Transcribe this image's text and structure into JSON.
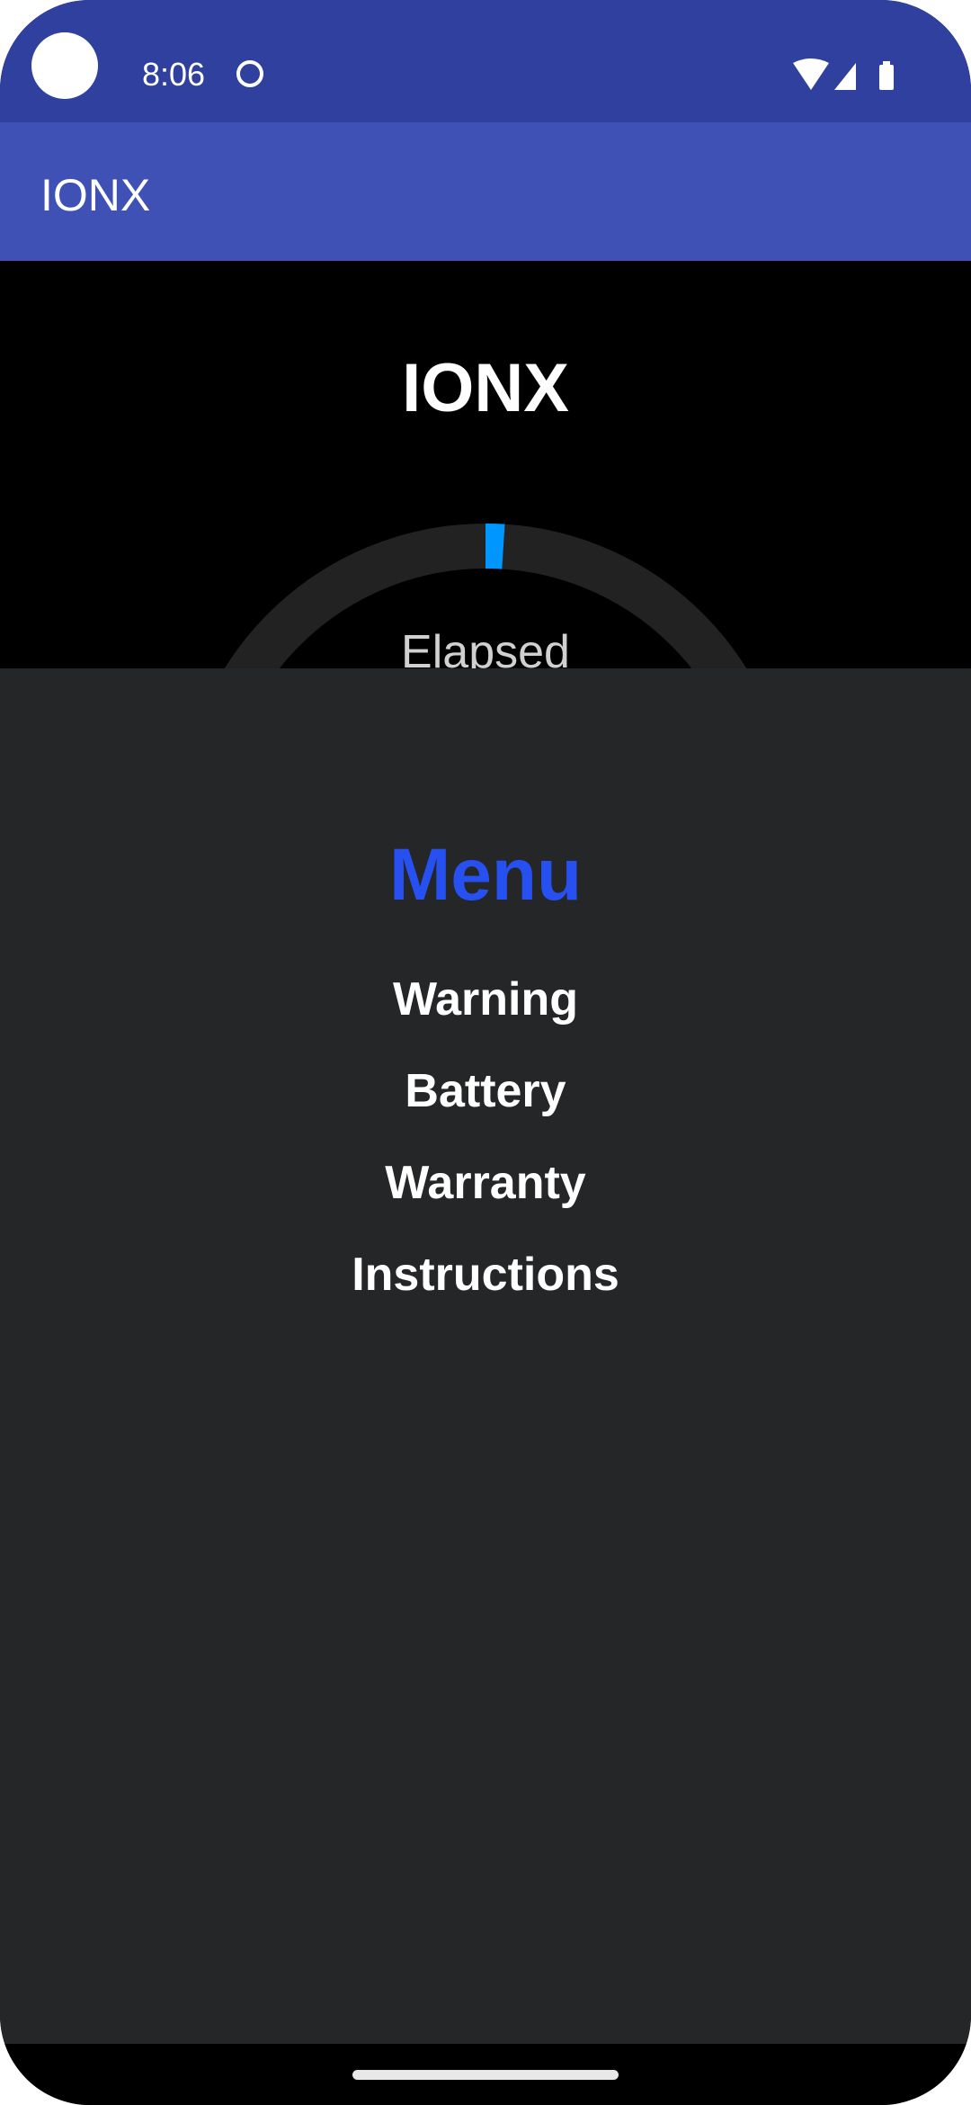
{
  "status_bar": {
    "time": "8:06",
    "icons": [
      "camera-cutout",
      "notification-icon",
      "wifi-icon",
      "signal-icon",
      "battery-icon"
    ]
  },
  "app_bar": {
    "title": "IONX"
  },
  "main": {
    "title": "IONX",
    "timer_label": "Elapsed",
    "progress_percent": 1,
    "colors": {
      "progress": "#0096ff",
      "track": "#222222"
    }
  },
  "menu": {
    "title": "Menu",
    "items": [
      {
        "label": "Warning"
      },
      {
        "label": "Battery"
      },
      {
        "label": "Warranty"
      },
      {
        "label": "Instructions"
      }
    ],
    "colors": {
      "title": "#2750f0",
      "background": "#252628"
    }
  },
  "colors": {
    "status_bar": "#2f409f",
    "app_bar": "#3f51b5"
  }
}
